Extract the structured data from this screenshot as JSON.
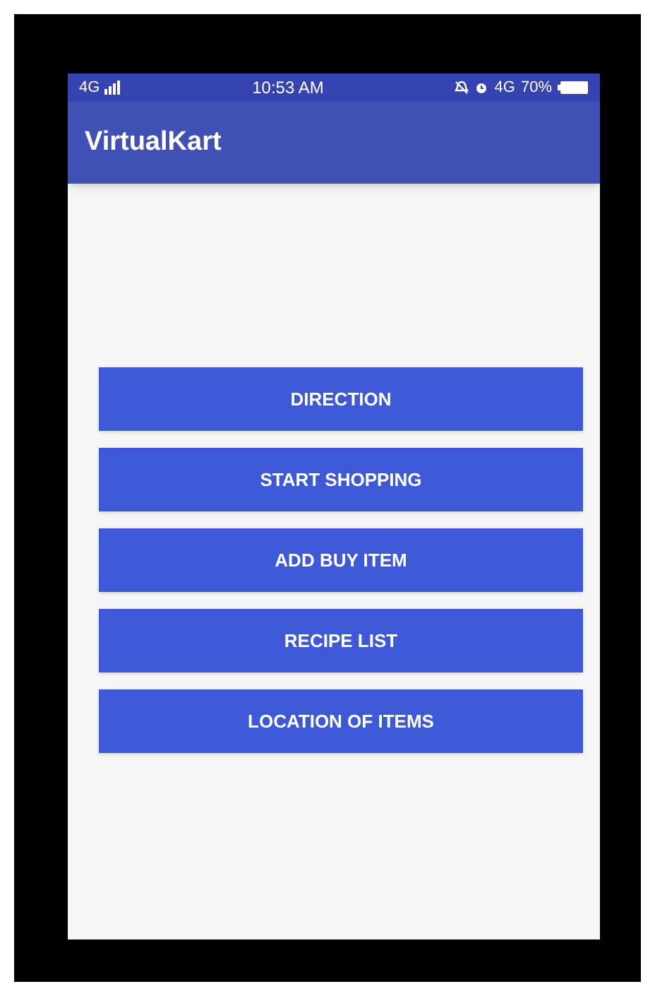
{
  "status_bar": {
    "network": "4G",
    "time": "10:53 AM",
    "network_right": "4G",
    "battery": "70%"
  },
  "app_bar": {
    "title": "VirtualKart"
  },
  "buttons": [
    "DIRECTION",
    "START SHOPPING",
    "ADD BUY ITEM",
    "RECIPE LIST",
    "LOCATION OF ITEMS"
  ]
}
